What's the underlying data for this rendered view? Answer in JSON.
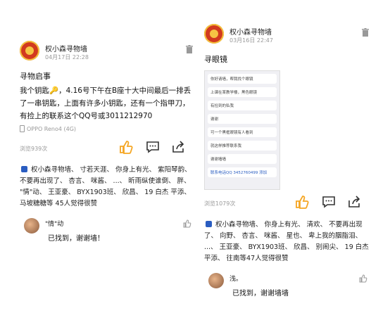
{
  "colors": {
    "accent": "#f5a623",
    "brand_red": "#d23a1f",
    "muted": "#999999",
    "link": "#2a5dc1"
  },
  "left_post": {
    "author": "权小森寻物墙",
    "time": "04月17日 22:28",
    "title": "寻物启事",
    "body": "我个钥匙🔑，4.16号下午在B座十大中间最后一排丢了一串钥匙，上面有许多小钥匙，还有一个指甲刀，有捡上的联系这个QQ号或3011212970",
    "device": "OPPO Reno4 (4G)",
    "views": "浏览939次",
    "likers": "权小森寻物墙、 寸若天涯、 你身上有光、 紫阳琴韵、 不要再出现了、 杏言、 咪酱、 ...、 昕雨纵使谁倒、 胖、 \"情\"动、 王亚豪、 BYX1903班、 欣昌、 19 白杰 平添、 马坡糖糖等 45人觉得很赞",
    "comment": {
      "name": "\"情\"动",
      "text": "已找到，谢谢墙！"
    }
  },
  "right_post": {
    "author": "权小森寻物墙",
    "time": "03月16日 22:47",
    "title": "寻眼镜",
    "screenshot_msgs": [
      "你好请墙，帮我找个眼镜",
      "上课在某教学楼，黑色眼镜",
      "有捡到的私我",
      "谢谢",
      "可一个黑框眼镜有人看到",
      "就这样推荐联系我",
      "谢谢墙墙",
      "联系电话QQ 3452760499 添加"
    ],
    "views": "浏览1079次",
    "likers": "权小森寻物墙、 你身上有光、 清欢、 不要再出现了、 向野、 杏言、 咪酱、 星也、 卑上我的胭脂泪、 ...、 王亚豪、 BYX1903班、 欣昌、 别闹尖、 19 白杰 平添、 往南等47人觉得很赞",
    "comment": {
      "name": "浅。",
      "text": "已找到，谢谢墙墙"
    }
  }
}
